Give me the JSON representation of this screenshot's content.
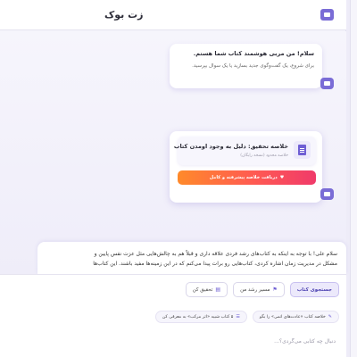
{
  "header": {
    "title": "زت بوک",
    "icon": "chat-bubble-icon"
  },
  "chat": {
    "welcome": {
      "line1": "سلام! من مربی هوشمند کتاب شما هستم.",
      "line2": "برای شروع، یک گفت‌وگوی جدید بسازید یا یک سوال بپرسید."
    },
    "summary_card": {
      "title": "خلاصه تحقیق: دلیل به وجود اومدن کتاب",
      "subtitle": "خلاصه محدود (نسخه رایگان)",
      "button_label": "دریافت خلاصه پیشرفته و کامل",
      "doc_icon": "document-icon"
    },
    "response": {
      "line1": "سلام علی! با توجه به اینکه به کتاب‌های رشد فردی علاقه داری و قبلاً هم به چالش‌هایی مثل عزت نفس پایین و",
      "line2": "مشکل در مدیریت زمان اشاره کردی، کتاب‌هایی رو برات پیدا می‌کنم که در این زمینه‌ها مفید باشند. این کتاب‌ها"
    }
  },
  "composer": {
    "modes": [
      {
        "label": "جستجوی کتاب",
        "active": true,
        "icon": ""
      },
      {
        "label": "مسیر رشد من",
        "active": false,
        "icon": "path-icon"
      },
      {
        "label": "تحقیق کن",
        "active": false,
        "icon": "research-icon"
      }
    ],
    "suggestions": [
      {
        "label": "خلاصه کتاب «عادت‌های اتمی» را بگو",
        "icon": "book-icon"
      },
      {
        "label": "۵ کتاب شبیه «اثر مرکب» به معرفی کن",
        "icon": "books-icon"
      }
    ],
    "input_placeholder": "دنبال چه کتابی می‌گردی؟..."
  },
  "colors": {
    "accent": "#7a6cd6",
    "button_gradient_start": "#ff8a2a",
    "button_gradient_end": "#f03a6a",
    "background": "#f4f3fb"
  }
}
